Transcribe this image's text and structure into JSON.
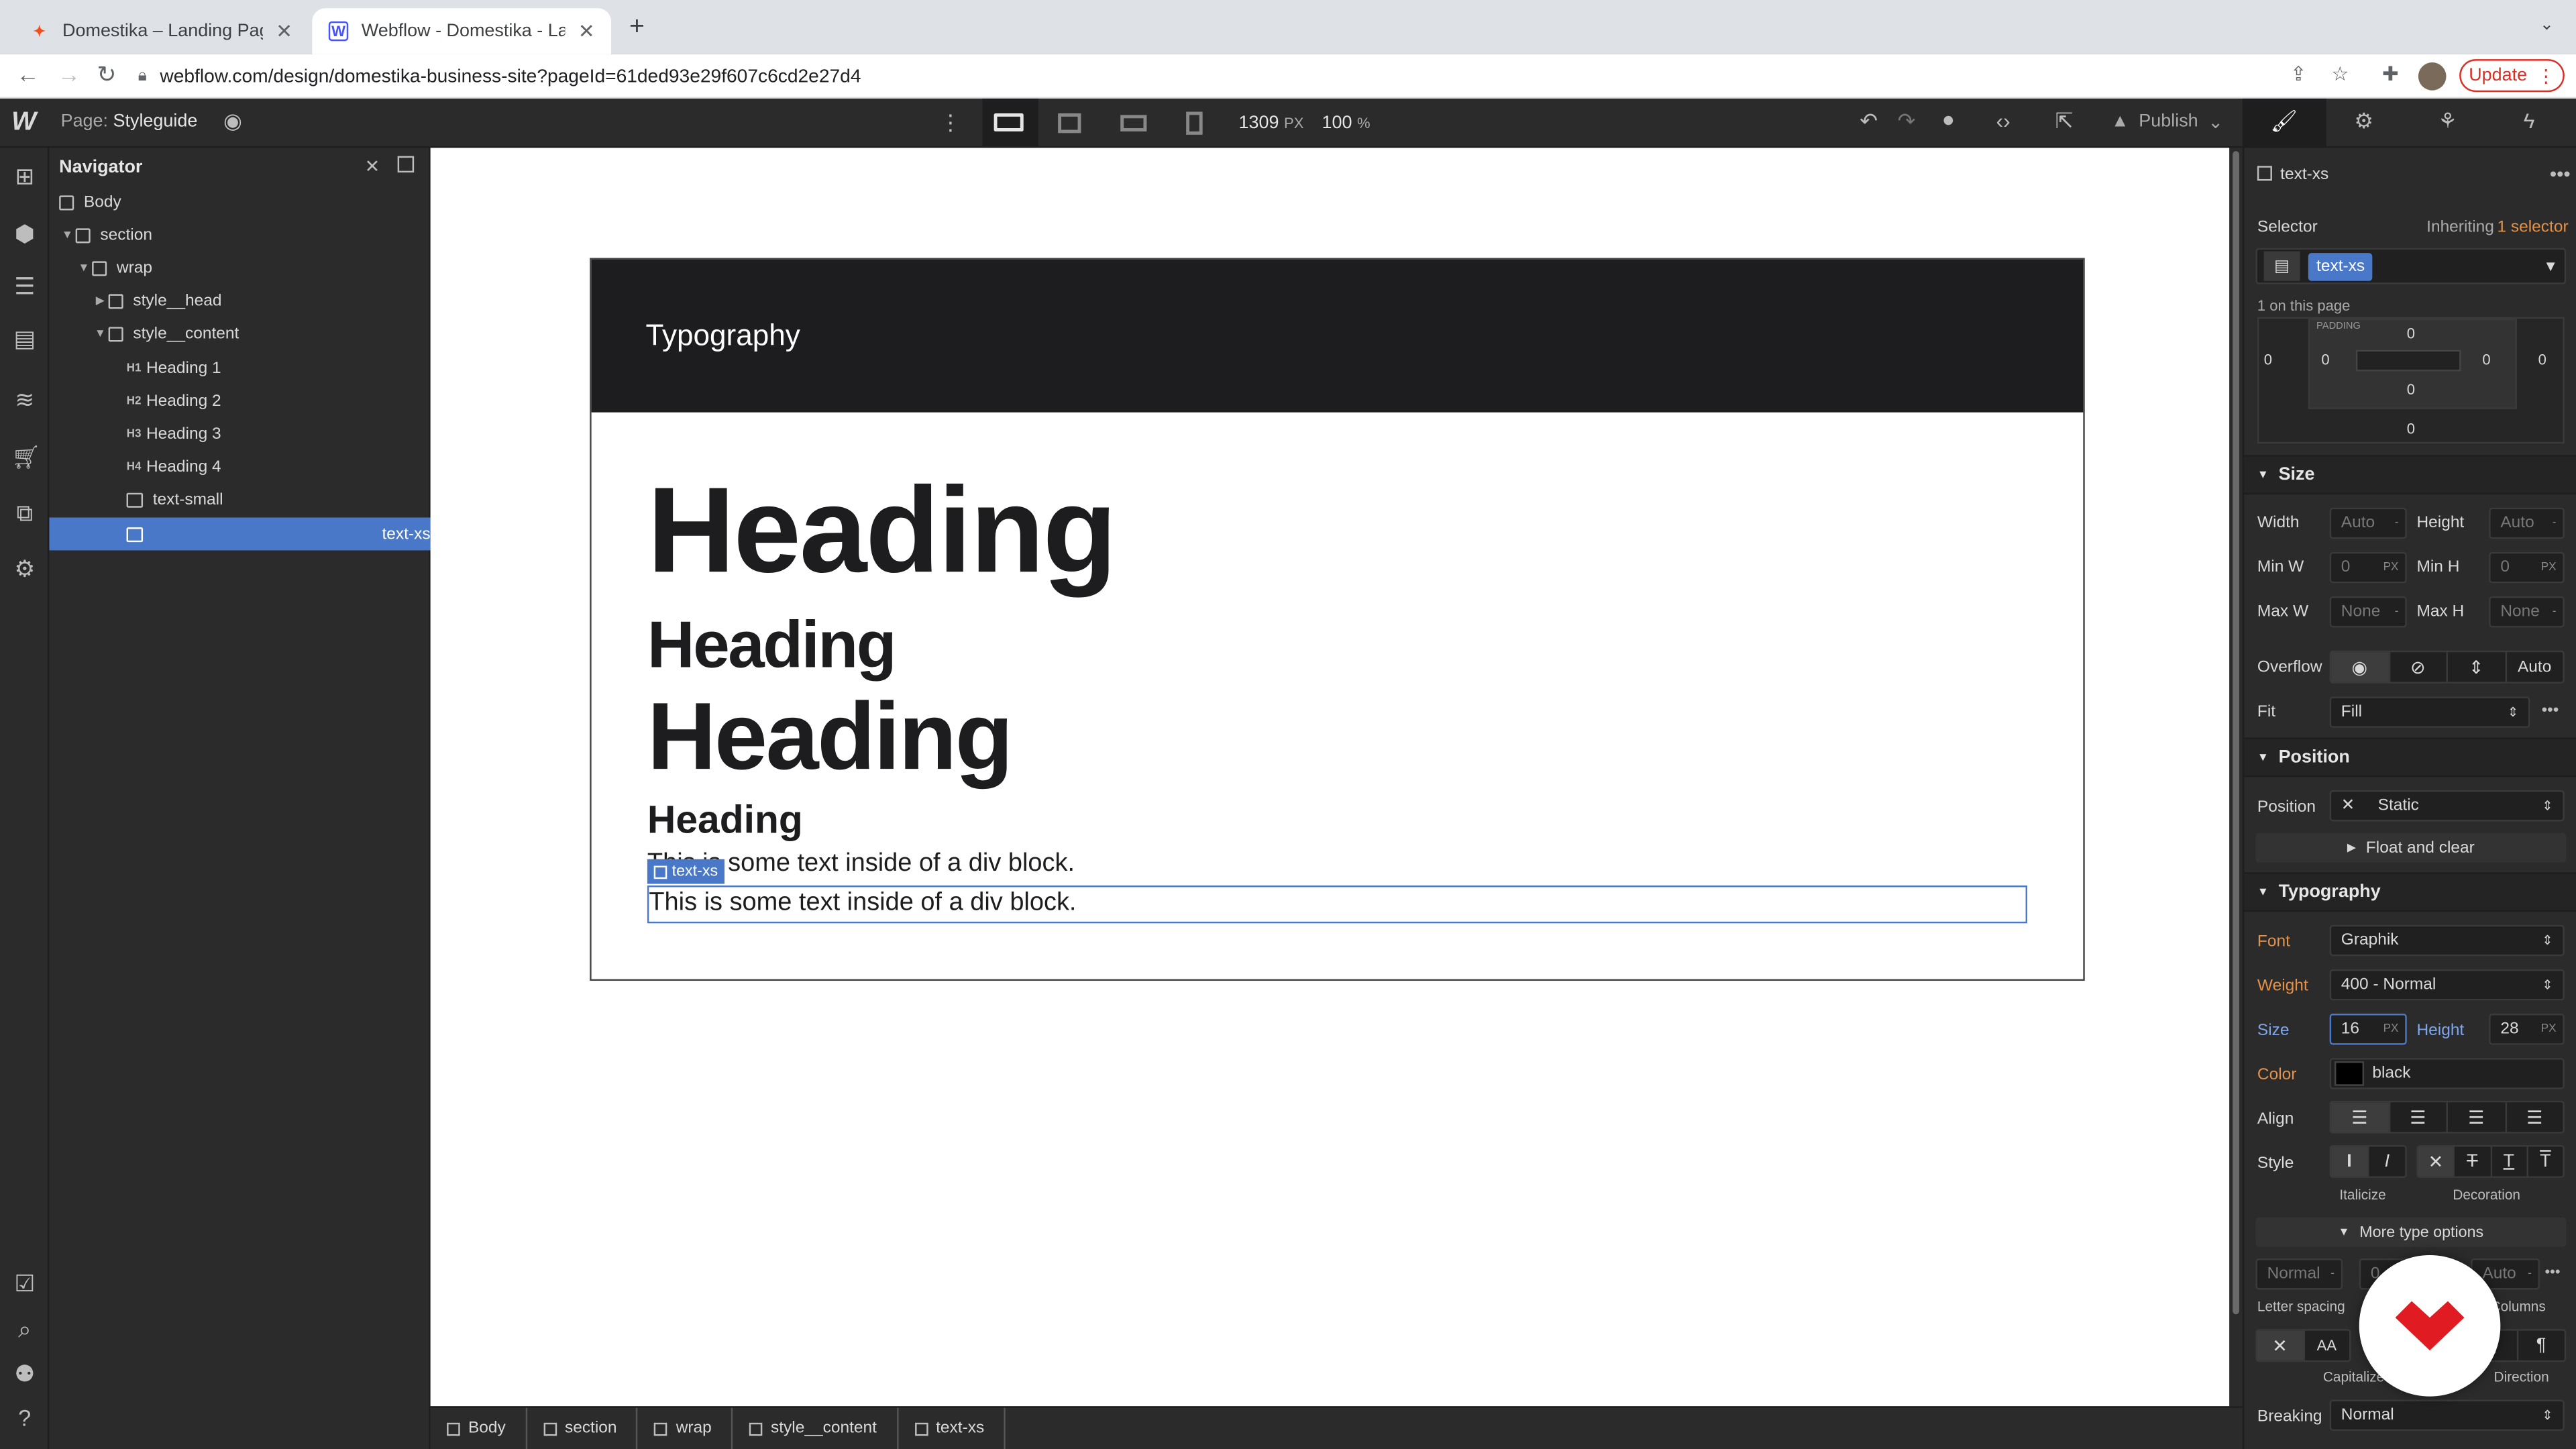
{
  "browser": {
    "tabs": [
      {
        "title": "Domestika – Landing Page – Fi",
        "icon": "figma-icon",
        "active": false
      },
      {
        "title": "Webflow - Domestika - Landin",
        "icon": "webflow-icon",
        "active": true
      }
    ],
    "new_tab": "+",
    "url": "webflow.com/design/domestika-business-site?pageId=61ded93e29f607c6cd2e27d4",
    "update_label": "Update"
  },
  "topbar": {
    "page_prefix": "Page:",
    "page_name": "Styleguide",
    "width_value": "1309",
    "width_unit": "PX",
    "zoom": "100",
    "zoom_unit": "%",
    "publish_label": "Publish"
  },
  "navigator": {
    "title": "Navigator",
    "items": [
      {
        "label": "Body",
        "badge": ""
      },
      {
        "label": "section",
        "badge": ""
      },
      {
        "label": "wrap",
        "badge": ""
      },
      {
        "label": "style__head",
        "badge": ""
      },
      {
        "label": "style__content",
        "badge": ""
      },
      {
        "label": "Heading 1",
        "badge": "H1"
      },
      {
        "label": "Heading 2",
        "badge": "H2"
      },
      {
        "label": "Heading 3",
        "badge": "H3"
      },
      {
        "label": "Heading 4",
        "badge": "H4"
      },
      {
        "label": "text-small",
        "badge": ""
      },
      {
        "label": "text-xs",
        "badge": ""
      }
    ]
  },
  "canvas": {
    "banner_title": "Typography",
    "heading1": "Heading",
    "heading2": "Heading",
    "heading3": "Heading",
    "heading4": "Heading",
    "text_small": "This is some text inside of a div block.",
    "text_xs": "This is some text inside of a div block.",
    "selected_badge": "text-xs"
  },
  "breadcrumbs": [
    "Body",
    "section",
    "wrap",
    "style__content",
    "text-xs"
  ],
  "style_panel": {
    "element_name": "text-xs",
    "selector_label": "Selector",
    "inheriting_label": "Inheriting",
    "inheriting_count": "1 selector",
    "selector_chip": "text-xs",
    "on_page": "1 on this page",
    "spacing": {
      "margin_left": "0",
      "padding_top": "0",
      "padding_left": "0",
      "padding_right": "0",
      "margin_right": "0",
      "padding_bottom": "0",
      "margin_bottom": "0",
      "padding_label": "PADDING"
    },
    "size": {
      "title": "Size",
      "width_label": "Width",
      "width": "Auto",
      "height_label": "Height",
      "height": "Auto",
      "minw_label": "Min W",
      "minw": "0",
      "minw_unit": "PX",
      "minh_label": "Min H",
      "minh": "0",
      "minh_unit": "PX",
      "maxw_label": "Max W",
      "maxw": "None",
      "maxh_label": "Max H",
      "maxh": "None",
      "overflow_label": "Overflow",
      "overflow_auto": "Auto",
      "fit_label": "Fit",
      "fit": "Fill"
    },
    "position": {
      "title": "Position",
      "position_label": "Position",
      "position": "Static",
      "float_clear": "Float and clear"
    },
    "typography": {
      "title": "Typography",
      "font_label": "Font",
      "font": "Graphik",
      "weight_label": "Weight",
      "weight": "400 - Normal",
      "size_label": "Size",
      "size": "16",
      "size_unit": "PX",
      "height_label": "Height",
      "height": "28",
      "height_unit": "PX",
      "color_label": "Color",
      "color_name": "black",
      "color_hex": "#000000",
      "align_label": "Align",
      "style_label": "Style",
      "italicize_label": "Italicize",
      "decoration_label": "Decoration",
      "more_options": "More type options",
      "letter_spacing": "Normal",
      "letter_spacing_label": "Letter spacing",
      "indent": "0",
      "columns": "Auto",
      "columns_label": "Columns",
      "capitalize_label": "Capitalize",
      "direction_label": "Direction",
      "breaking_label": "Breaking",
      "breaking": "Normal"
    }
  },
  "colors": {
    "accent": "#4a78c8",
    "panel_bg": "#2b2b2b",
    "orange_label": "#e3924a",
    "domestika_red": "#e11b22"
  }
}
